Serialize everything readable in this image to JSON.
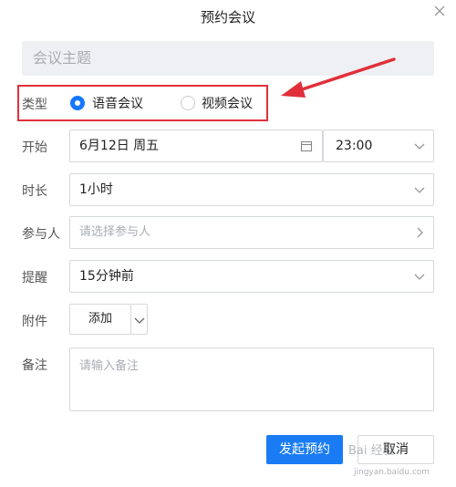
{
  "dialog": {
    "title": "预约会议",
    "subject_placeholder": "会议主题"
  },
  "type": {
    "label": "类型",
    "options": [
      {
        "label": "语音会议",
        "selected": true
      },
      {
        "label": "视频会议",
        "selected": false
      }
    ]
  },
  "start": {
    "label": "开始",
    "date": "6月12日 周五",
    "time": "23:00"
  },
  "duration": {
    "label": "时长",
    "value": "1小时"
  },
  "participants": {
    "label": "参与人",
    "placeholder": "请选择参与人"
  },
  "reminder": {
    "label": "提醒",
    "value": "15分钟前"
  },
  "attachment": {
    "label": "附件",
    "button": "添加"
  },
  "note": {
    "label": "备注",
    "placeholder": "请输入备注"
  },
  "actions": {
    "submit": "发起预约",
    "cancel": "取消"
  },
  "watermark": {
    "brand": "Bai 经验",
    "url": "jingyan.baidu.com"
  },
  "colors": {
    "accent": "#1a7cf5",
    "highlight": "#e0303a"
  },
  "icons": {
    "close": "close-icon",
    "calendar": "calendar-icon",
    "chevron": "chevron-down-icon",
    "arrow": "red-arrow-annotation"
  }
}
